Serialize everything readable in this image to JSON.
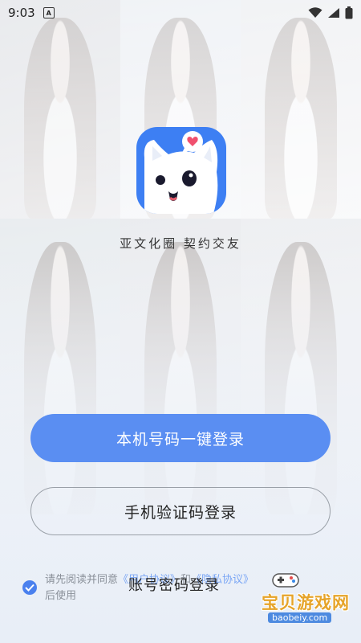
{
  "status_bar": {
    "time": "9:03",
    "keyboard_badge": "A"
  },
  "app": {
    "slogan": "亚文化圈 契约交友"
  },
  "buttons": {
    "one_click_login": "本机号码一键登录",
    "sms_login": "手机验证码登录",
    "password_login": "账号密码登录"
  },
  "agreement": {
    "prefix": "请先阅读并同意",
    "link1": "《用户协议》",
    "and": "和",
    "link2": "《隐私协议》",
    "suffix": "后使用",
    "checked": true
  },
  "watermark": {
    "title": "宝贝游戏网",
    "url": "baobeiy.com"
  },
  "colors": {
    "primary": "#5a8ef2",
    "logo_bg": "#3d7ff3",
    "link": "#7aa6f5"
  }
}
